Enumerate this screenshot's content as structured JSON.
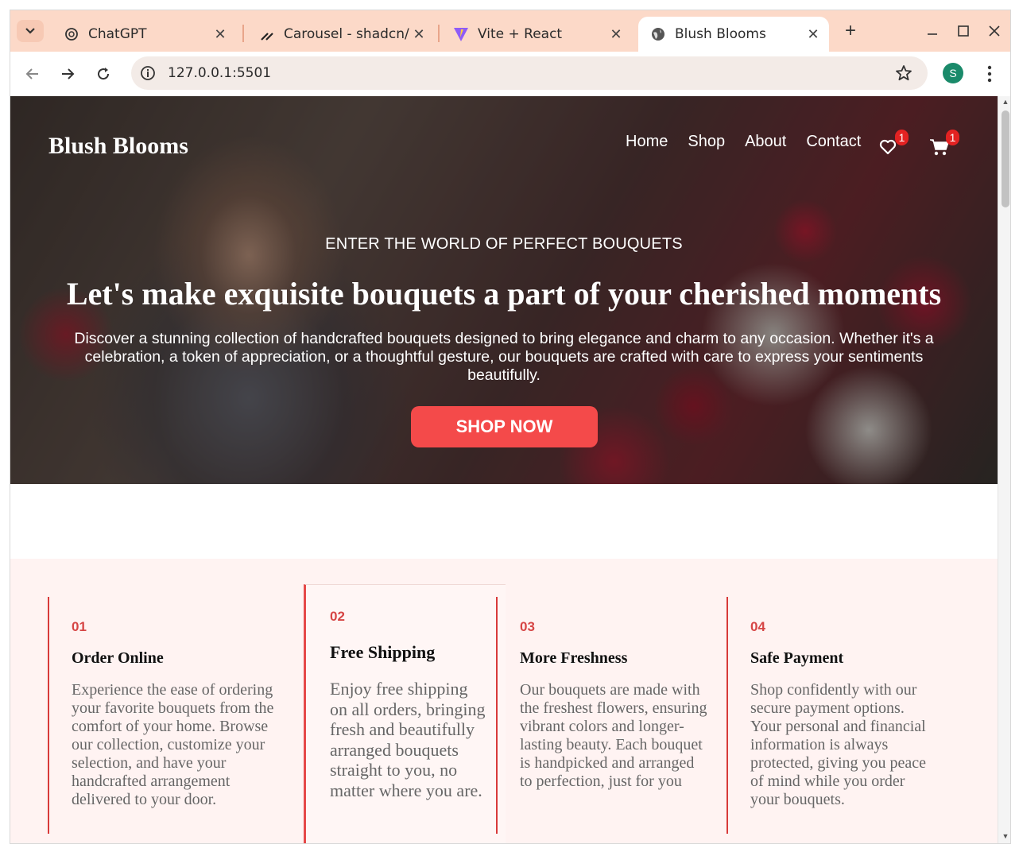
{
  "browser": {
    "tabs": [
      {
        "title": "ChatGPT",
        "icon": "openai-icon",
        "active": false
      },
      {
        "title": "Carousel - shadcn/",
        "icon": "shadcn-icon",
        "active": false
      },
      {
        "title": "Vite + React",
        "icon": "vite-icon",
        "active": false
      },
      {
        "title": "Blush Blooms",
        "icon": "globe-icon",
        "active": true
      }
    ],
    "url": "127.0.0.1:5501",
    "profile_initial": "S"
  },
  "site": {
    "brand": "Blush Blooms",
    "nav": [
      "Home",
      "Shop",
      "About",
      "Contact"
    ],
    "wishlist_count": "1",
    "cart_count": "1"
  },
  "hero": {
    "eyebrow": "ENTER THE WORLD OF PERFECT BOUQUETS",
    "headline": "Let's make exquisite bouquets a part of your cherished moments",
    "description": "Discover a stunning collection of handcrafted bouquets designed to bring elegance and charm to any occasion. Whether it's a celebration, a token of appreciation, or a thoughtful gesture, our bouquets are crafted with care to express your sentiments beautifully.",
    "cta": "SHOP NOW"
  },
  "features": [
    {
      "num": "01",
      "title": "Order Online",
      "text": "Experience the ease of ordering your favorite bouquets from the comfort of your home. Browse our collection, customize your selection, and have your handcrafted arrangement delivered to your door."
    },
    {
      "num": "02",
      "title": "Free Shipping",
      "text": "Enjoy free shipping on all orders, bringing fresh and beautifully arranged bouquets straight to you, no matter where you are."
    },
    {
      "num": "03",
      "title": "More Freshness",
      "text": "Our bouquets are made with the freshest flowers, ensuring vibrant colors and longer-lasting beauty. Each bouquet is handpicked and arranged to perfection, just for you"
    },
    {
      "num": "04",
      "title": "Safe Payment",
      "text": "Shop confidently with our secure payment options. Your personal and financial information is always protected, giving you peace of mind while you order your bouquets."
    }
  ],
  "colors": {
    "accent": "#f44a4a",
    "tabbar": "#fcd9c8",
    "features_bg": "#fff3f2"
  }
}
